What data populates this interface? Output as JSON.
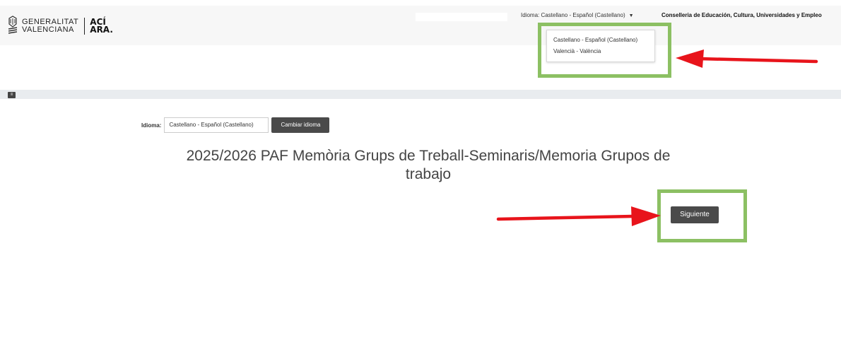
{
  "header": {
    "logo": {
      "line1": "GENERALITAT",
      "line2": "VALENCIANA",
      "aci": "ACÍ",
      "ara": "ARA."
    },
    "language_selector": "Idioma: Castellano - Español (Castellano)",
    "language_caret_icon": "caret-down-icon",
    "department": "Conselleria de Educación, Cultura, Universidades y Empleo"
  },
  "language_dropdown": {
    "options": [
      "Castellano - Español (Castellano)",
      "Valencià - València"
    ]
  },
  "band": {
    "icon": "toggle-icon"
  },
  "language_form": {
    "label": "Idioma:",
    "selected": "Castellano - Español (Castellano)",
    "button": "Cambiar idioma"
  },
  "main": {
    "title_line1": "2025/2026 PAF Memòria Grups de Treball-Seminaris/Memoria Grupos de",
    "title_line2": "trabajo",
    "next_button": "Siguiente"
  },
  "annotations": {
    "highlight_color": "#8cc063",
    "arrow_color": "#e8141b"
  }
}
